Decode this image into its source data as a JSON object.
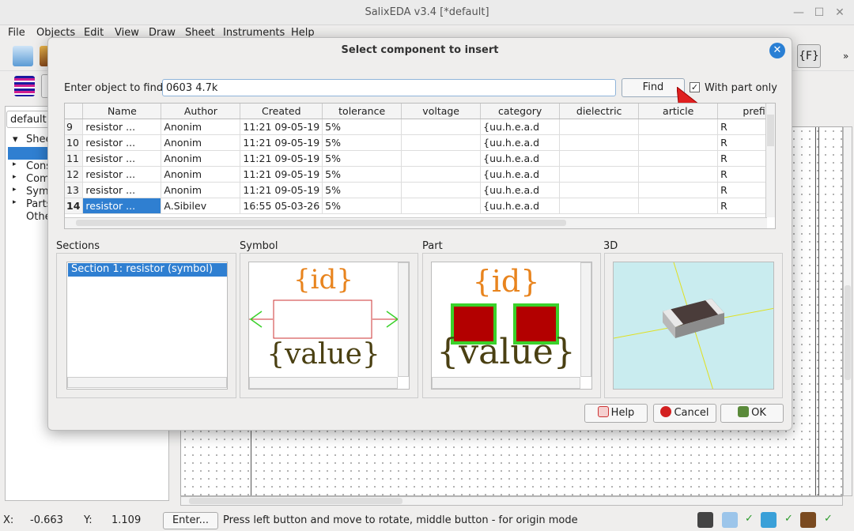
{
  "window": {
    "title": "SalixEDA v3.4 [*default]"
  },
  "menu": [
    "File",
    "Objects",
    "Edit",
    "View",
    "Draw",
    "Sheet",
    "Instruments",
    "Help"
  ],
  "left": {
    "combo": "default",
    "tree": [
      "Shee",
      "Cons",
      "Comp",
      "Sym",
      "Parts",
      "Othe"
    ]
  },
  "dialog": {
    "title": "Select component to insert",
    "find_label": "Enter object to find:",
    "find_value": "0603 4.7k",
    "find_button": "Find",
    "with_part_only": "With part only",
    "columns": [
      "Name",
      "Author",
      "Created",
      "tolerance",
      "voltage",
      "category",
      "dielectric",
      "article",
      "prefix"
    ],
    "rows": [
      {
        "n": "9",
        "name": "resistor ...",
        "author": "Anonim",
        "created": "11:21 09-05-19",
        "tol": "5%",
        "volt": "",
        "cat": "{uu.h.e.a.d",
        "diel": "",
        "art": "",
        "prefix": "R"
      },
      {
        "n": "10",
        "name": "resistor ...",
        "author": "Anonim",
        "created": "11:21 09-05-19",
        "tol": "5%",
        "volt": "",
        "cat": "{uu.h.e.a.d",
        "diel": "",
        "art": "",
        "prefix": "R"
      },
      {
        "n": "11",
        "name": "resistor ...",
        "author": "Anonim",
        "created": "11:21 09-05-19",
        "tol": "5%",
        "volt": "",
        "cat": "{uu.h.e.a.d",
        "diel": "",
        "art": "",
        "prefix": "R"
      },
      {
        "n": "12",
        "name": "resistor ...",
        "author": "Anonim",
        "created": "11:21 09-05-19",
        "tol": "5%",
        "volt": "",
        "cat": "{uu.h.e.a.d",
        "diel": "",
        "art": "",
        "prefix": "R"
      },
      {
        "n": "13",
        "name": "resistor ...",
        "author": "Anonim",
        "created": "11:21 09-05-19",
        "tol": "5%",
        "volt": "",
        "cat": "{uu.h.e.a.d",
        "diel": "",
        "art": "",
        "prefix": "R"
      },
      {
        "n": "14",
        "name": "resistor ...",
        "author": "A.Sibilev",
        "created": "16:55 05-03-26",
        "tol": "5%",
        "volt": "",
        "cat": "{uu.h.e.a.d",
        "diel": "",
        "art": "",
        "prefix": "R"
      }
    ],
    "selected_row": "14",
    "sections_label": "Sections",
    "section_item": "Section 1: resistor (symbol)",
    "symbol_label": "Symbol",
    "part_label": "Part",
    "model3d_label": "3D",
    "id_text": "{id}",
    "value_text": "{value}",
    "help_button": "Help",
    "cancel_button": "Cancel",
    "ok_button": "OK"
  },
  "status": {
    "x_label": "X:",
    "x_value": "-0.663",
    "y_label": "Y:",
    "y_value": "1.109",
    "enter_button": "Enter...",
    "message": "Press left button and move to rotate, middle button - for origin mode"
  },
  "colors": {
    "accent": "#2f7fd1",
    "symbol_text": "#e8841e",
    "value_text": "#4a4012",
    "pad_fill": "#b30000",
    "pad_border": "#3ad12a",
    "model_bg": "#c9ecef"
  }
}
